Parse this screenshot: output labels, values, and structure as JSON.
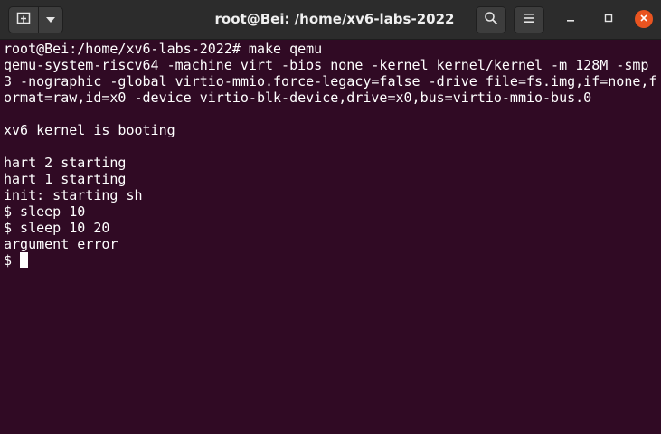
{
  "window": {
    "title": "root@Bei: /home/xv6-labs-2022"
  },
  "icons": {
    "new_tab": "terminal-new-tab-icon",
    "dropdown": "chevron-down-icon",
    "search": "search-icon",
    "menu": "hamburger-menu-icon",
    "minimize": "minimize-icon",
    "maximize": "maximize-icon",
    "close": "close-icon"
  },
  "colors": {
    "terminal_bg": "#300a24",
    "titlebar_bg": "#2c2c2c",
    "close_button": "#e95420",
    "text": "#ffffff"
  },
  "terminal": {
    "lines": [
      "root@Bei:/home/xv6-labs-2022# make qemu",
      "qemu-system-riscv64 -machine virt -bios none -kernel kernel/kernel -m 128M -smp",
      "3 -nographic -global virtio-mmio.force-legacy=false -drive file=fs.img,if=none,f",
      "ormat=raw,id=x0 -device virtio-blk-device,drive=x0,bus=virtio-mmio-bus.0",
      "",
      "xv6 kernel is booting",
      "",
      "hart 2 starting",
      "hart 1 starting",
      "init: starting sh",
      "$ sleep 10",
      "$ sleep 10 20",
      "argument error"
    ],
    "prompt": "$ "
  }
}
